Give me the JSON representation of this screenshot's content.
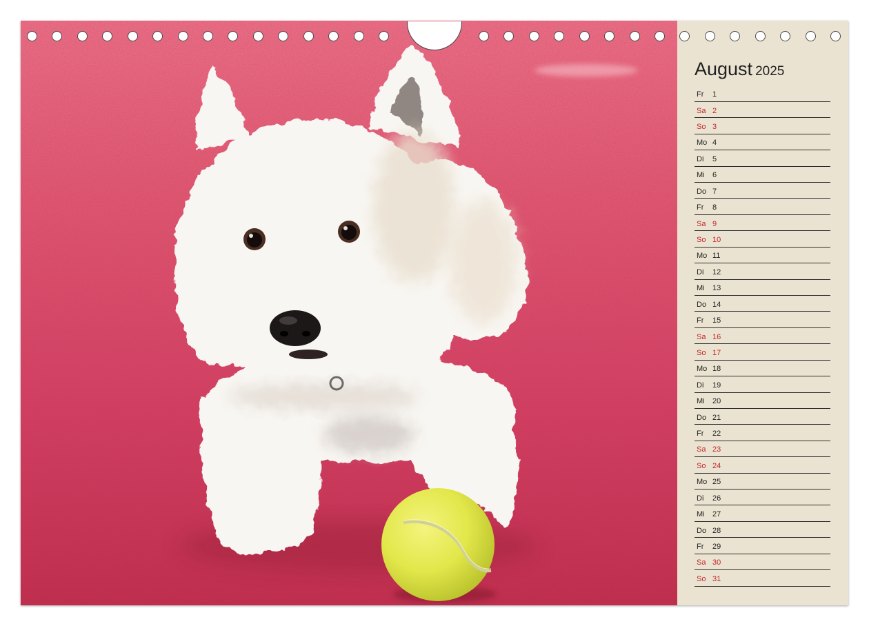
{
  "calendar": {
    "month": "August",
    "year": "2025"
  },
  "days": [
    {
      "wd": "Fr",
      "d": 1,
      "weekend": false
    },
    {
      "wd": "Sa",
      "d": 2,
      "weekend": true
    },
    {
      "wd": "So",
      "d": 3,
      "weekend": true
    },
    {
      "wd": "Mo",
      "d": 4,
      "weekend": false
    },
    {
      "wd": "Di",
      "d": 5,
      "weekend": false
    },
    {
      "wd": "Mi",
      "d": 6,
      "weekend": false
    },
    {
      "wd": "Do",
      "d": 7,
      "weekend": false
    },
    {
      "wd": "Fr",
      "d": 8,
      "weekend": false
    },
    {
      "wd": "Sa",
      "d": 9,
      "weekend": true
    },
    {
      "wd": "So",
      "d": 10,
      "weekend": true
    },
    {
      "wd": "Mo",
      "d": 11,
      "weekend": false
    },
    {
      "wd": "Di",
      "d": 12,
      "weekend": false
    },
    {
      "wd": "Mi",
      "d": 13,
      "weekend": false
    },
    {
      "wd": "Do",
      "d": 14,
      "weekend": false
    },
    {
      "wd": "Fr",
      "d": 15,
      "weekend": false
    },
    {
      "wd": "Sa",
      "d": 16,
      "weekend": true
    },
    {
      "wd": "So",
      "d": 17,
      "weekend": true
    },
    {
      "wd": "Mo",
      "d": 18,
      "weekend": false
    },
    {
      "wd": "Di",
      "d": 19,
      "weekend": false
    },
    {
      "wd": "Mi",
      "d": 20,
      "weekend": false
    },
    {
      "wd": "Do",
      "d": 21,
      "weekend": false
    },
    {
      "wd": "Fr",
      "d": 22,
      "weekend": false
    },
    {
      "wd": "Sa",
      "d": 23,
      "weekend": true
    },
    {
      "wd": "So",
      "d": 24,
      "weekend": true
    },
    {
      "wd": "Mo",
      "d": 25,
      "weekend": false
    },
    {
      "wd": "Di",
      "d": 26,
      "weekend": false
    },
    {
      "wd": "Mi",
      "d": 27,
      "weekend": false
    },
    {
      "wd": "Do",
      "d": 28,
      "weekend": false
    },
    {
      "wd": "Fr",
      "d": 29,
      "weekend": false
    },
    {
      "wd": "Sa",
      "d": 30,
      "weekend": true
    },
    {
      "wd": "So",
      "d": 31,
      "weekend": true
    }
  ],
  "colors": {
    "panel": "#ebe3d1",
    "weekend": "#c0272d",
    "text": "#222222"
  }
}
